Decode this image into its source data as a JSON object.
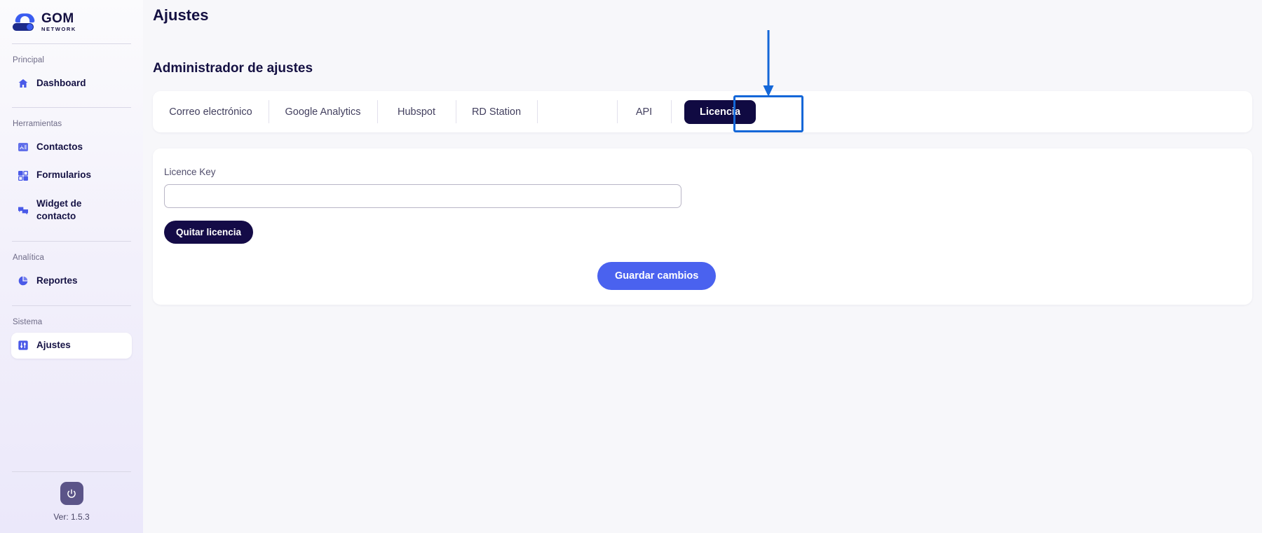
{
  "brand": {
    "name": "GOM",
    "subtitle": "NETWORK",
    "logo_icon": "cloud-network-logo"
  },
  "sidebar": {
    "sections": [
      {
        "label": "Principal",
        "items": [
          {
            "label": "Dashboard",
            "icon": "home-icon",
            "active": false
          }
        ]
      },
      {
        "label": "Herramientas",
        "items": [
          {
            "label": "Contactos",
            "icon": "contacts-icon",
            "active": false
          },
          {
            "label": "Formularios",
            "icon": "forms-icon",
            "active": false
          },
          {
            "label": "Widget de contacto",
            "icon": "chat-bubbles-icon",
            "active": false
          }
        ]
      },
      {
        "label": "Analítica",
        "items": [
          {
            "label": "Reportes",
            "icon": "pie-chart-icon",
            "active": false
          }
        ]
      },
      {
        "label": "Sistema",
        "items": [
          {
            "label": "Ajustes",
            "icon": "sliders-icon",
            "active": true
          }
        ]
      }
    ],
    "footer": {
      "power_icon": "power-icon",
      "version": "Ver: 1.5.3"
    }
  },
  "main": {
    "page_title": "Ajustes",
    "section_title": "Administrador de ajustes",
    "tabs": [
      {
        "label": "Correo electrónico",
        "active": false
      },
      {
        "label": "Google Analytics",
        "active": false
      },
      {
        "label": "Hubspot",
        "active": false
      },
      {
        "label": "RD Station",
        "active": false
      },
      {
        "label": "",
        "active": false
      },
      {
        "label": "API",
        "active": false
      },
      {
        "label": "Licencia",
        "active": true
      }
    ],
    "form": {
      "licence_label": "Licence Key",
      "licence_value": "",
      "licence_placeholder": "",
      "remove_button": "Quitar licencia",
      "save_button": "Guardar cambios"
    }
  },
  "annotation": {
    "highlight_color": "#1467d8",
    "arrow_icon": "down-arrow-annotation",
    "target": "Licencia"
  },
  "colors": {
    "accent_blue": "#4a62ef",
    "dark_navy": "#140b47",
    "sidebar_active_bg": "#ffffff",
    "highlight": "#1467d8"
  }
}
